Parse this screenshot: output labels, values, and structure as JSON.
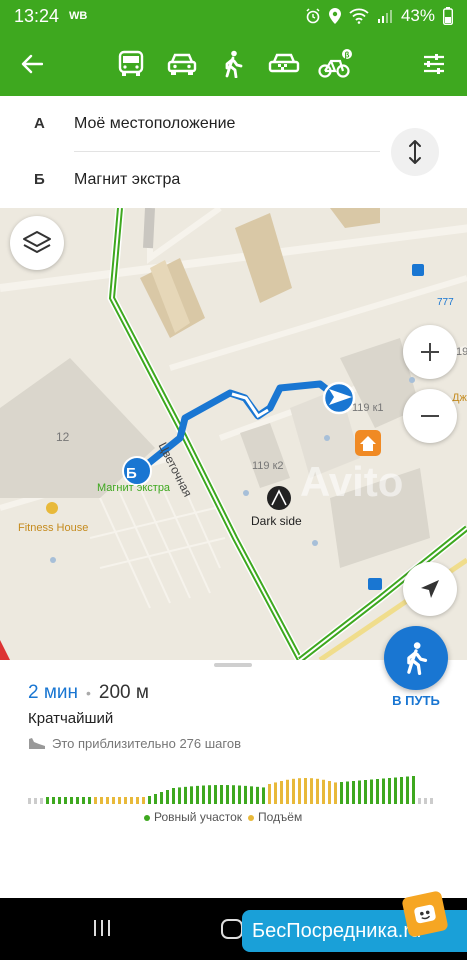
{
  "status": {
    "time": "13:24",
    "carrier": "WB",
    "battery": "43%"
  },
  "toolbar": {
    "back": "back",
    "modes": [
      "bus",
      "car",
      "walk",
      "taxi",
      "bike"
    ],
    "active_mode": "walk",
    "settings": "settings"
  },
  "route_points": {
    "a_letter": "A",
    "a_name": "Моё местоположение",
    "b_letter": "Б",
    "b_name": "Магнит экстра"
  },
  "map": {
    "street_name": "Цветочная",
    "store_name": "Магнит экстра",
    "fitness_label": "Fitness House",
    "poi_label": "Dark side",
    "building_1": "119 к1",
    "building_2": "119 к2",
    "building_3": "12",
    "building_4": "19",
    "bus_stop": "777",
    "marker_b": "Б",
    "edge_label": "Дж",
    "watermark": "Avito"
  },
  "route": {
    "duration": "2 мин",
    "distance": "200 м",
    "type": "Кратчайший",
    "steps": "Это приблизительно 276 шагов",
    "legend_flat": "Ровный участок",
    "legend_up": "Подъём",
    "go_label": "В ПУТЬ"
  },
  "colors": {
    "green_bar": "#3ea81f",
    "route_blue": "#1976d2",
    "flat": "#3ea81f",
    "uphill": "#e8b93a"
  },
  "watermark_site": {
    "text": "БесПосредника",
    "suffix": ".ru"
  }
}
